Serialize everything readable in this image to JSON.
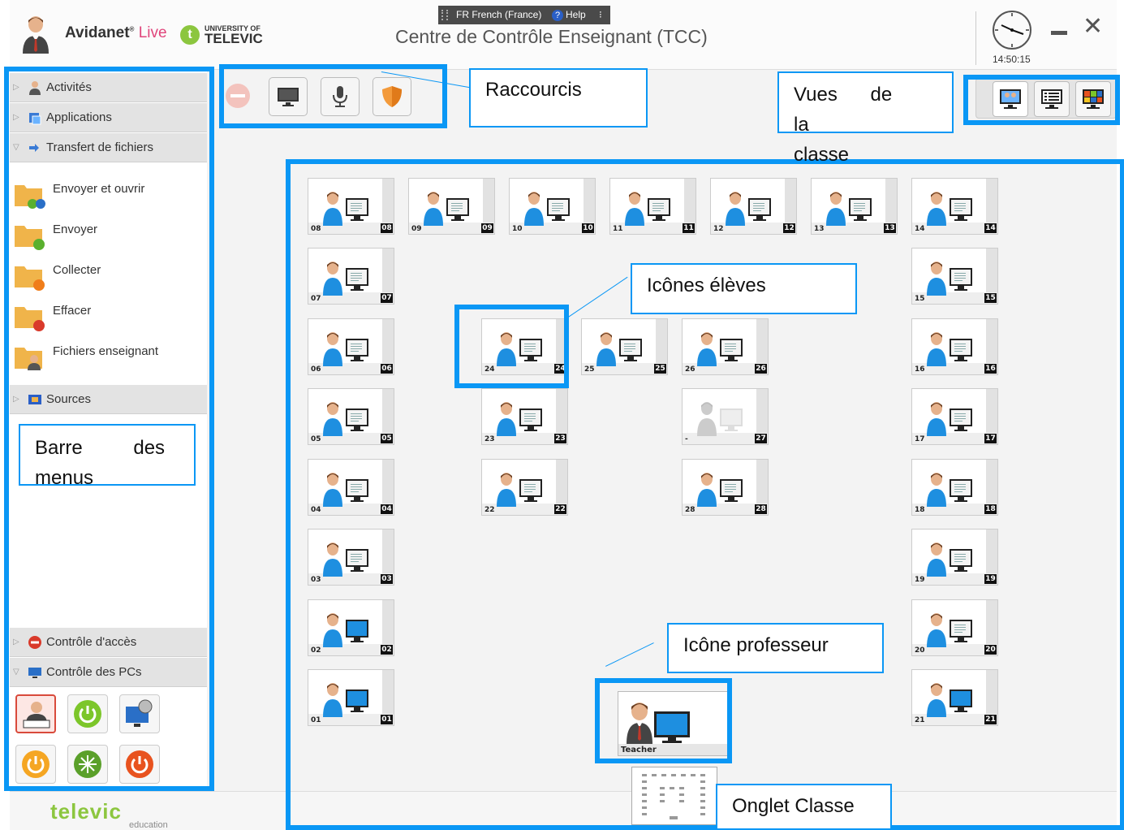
{
  "header": {
    "brand": "Avidanet",
    "brand_live": "Live",
    "brand_reg": "®",
    "uni_top": "UNIVERSITY OF",
    "uni_name": "TELEVIC",
    "uni_letter": "t",
    "language": "FR French (France)",
    "help": "Help",
    "title": "Centre de Contrôle Enseignant (TCC)",
    "time": "14:50:15"
  },
  "sidebar": {
    "sections": {
      "activites": "Activités",
      "applications": "Applications",
      "transfert": "Transfert de fichiers",
      "sources": "Sources",
      "controle_acces": "Contrôle d'accès",
      "controle_pcs": "Contrôle des PCs"
    },
    "file_items": [
      {
        "label": "Envoyer et ouvrir"
      },
      {
        "label": "Envoyer"
      },
      {
        "label": "Collecter"
      },
      {
        "label": "Effacer"
      },
      {
        "label": "Fichiers enseignant"
      }
    ]
  },
  "footer": {
    "logo": "televic",
    "logo_sub": "education"
  },
  "teacher": {
    "label": "Teacher"
  },
  "students": [
    {
      "left_label": "08",
      "number": "08"
    },
    {
      "left_label": "09",
      "number": "09"
    },
    {
      "left_label": "10",
      "number": "10"
    },
    {
      "left_label": "11",
      "number": "11"
    },
    {
      "left_label": "12",
      "number": "12"
    },
    {
      "left_label": "13",
      "number": "13"
    },
    {
      "left_label": "14",
      "number": "14"
    },
    {
      "left_label": "07",
      "number": "07"
    },
    {
      "left_label": "15",
      "number": "15"
    },
    {
      "left_label": "06",
      "number": "06"
    },
    {
      "left_label": "24",
      "number": "24"
    },
    {
      "left_label": "25",
      "number": "25"
    },
    {
      "left_label": "26",
      "number": "26"
    },
    {
      "left_label": "16",
      "number": "16"
    },
    {
      "left_label": "05",
      "number": "05"
    },
    {
      "left_label": "23",
      "number": "23"
    },
    {
      "left_label": "-",
      "number": "27",
      "inactive": true
    },
    {
      "left_label": "17",
      "number": "17"
    },
    {
      "left_label": "04",
      "number": "04"
    },
    {
      "left_label": "22",
      "number": "22"
    },
    {
      "left_label": "28",
      "number": "28"
    },
    {
      "left_label": "18",
      "number": "18"
    },
    {
      "left_label": "03",
      "number": "03"
    },
    {
      "left_label": "19",
      "number": "19"
    },
    {
      "left_label": "02",
      "number": "02",
      "active_screen": true
    },
    {
      "left_label": "20",
      "number": "20"
    },
    {
      "left_label": "01",
      "number": "01",
      "active_screen": true
    },
    {
      "left_label": "21",
      "number": "21",
      "active_screen": true
    }
  ],
  "annotations": {
    "raccourcis": "Raccourcis",
    "vues_1": "Vues de la",
    "vues_2": "classe",
    "barre_1": "Barre des",
    "barre_2": "menus",
    "icones_eleves": "Icônes élèves",
    "icone_professeur": "Icône professeur",
    "onglet_classe": "Onglet Classe"
  },
  "colors": {
    "annotation": "#0a97f5",
    "accent_green": "#8cc63f",
    "brand_pink": "#e0457b"
  }
}
